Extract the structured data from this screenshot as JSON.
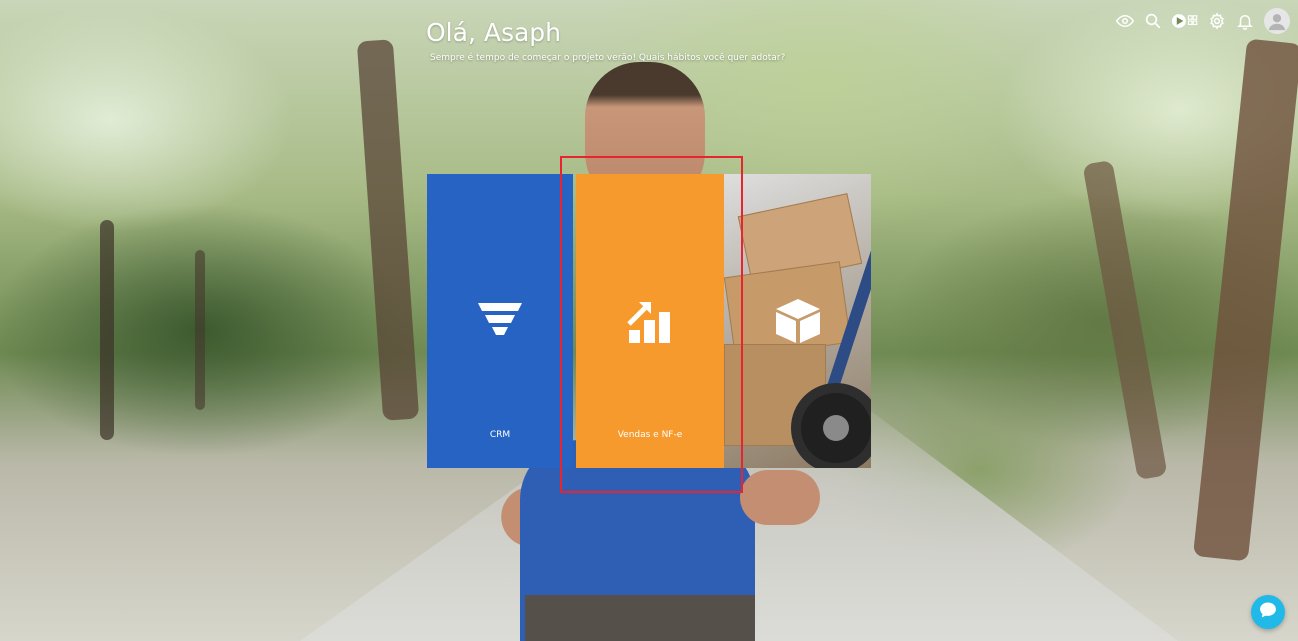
{
  "header": {
    "greeting": "Olá, Asaph",
    "subtitle": "Sempre é tempo de começar o projeto verão! Quais hábitos você quer adotar?"
  },
  "toolbar": {
    "icons": [
      "eye-icon",
      "search-icon",
      "play-apps-icon",
      "settings-icon",
      "bell-icon",
      "user-avatar"
    ]
  },
  "tiles": [
    {
      "label": "CRM",
      "icon": "funnel-icon",
      "color": "#2763c2"
    },
    {
      "label": "Vendas e NF-e",
      "icon": "growth-chart-icon",
      "color": "#f79a2e"
    },
    {
      "label": "",
      "icon": "box-icon",
      "color": ""
    }
  ],
  "colors": {
    "highlight": "#e8242f",
    "chat": "#20b9e8"
  },
  "chat": {
    "icon": "chat-icon"
  }
}
